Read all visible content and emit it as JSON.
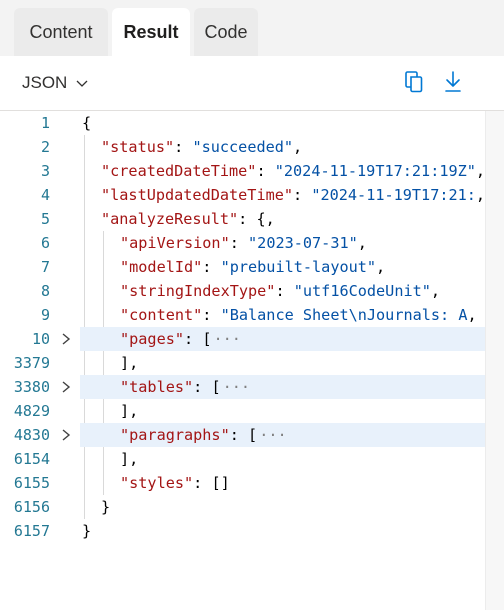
{
  "tabs": [
    {
      "label": "Content"
    },
    {
      "label": "Result"
    },
    {
      "label": "Code"
    }
  ],
  "toolbar": {
    "format_label": "JSON",
    "copy_icon": "copy-icon",
    "download_icon": "download-icon"
  },
  "editor": {
    "lines": [
      {
        "num": "1",
        "key": "",
        "value": "{"
      },
      {
        "num": "2",
        "key": "\"status\"",
        "value": "\"succeeded\""
      },
      {
        "num": "3",
        "key": "\"createdDateTime\"",
        "value": "\"2024-11-19T17:21:19Z\""
      },
      {
        "num": "4",
        "key": "\"lastUpdatedDateTime\"",
        "value": "\"2024-11-19T17:21:"
      },
      {
        "num": "5",
        "key": "\"analyzeResult\"",
        "value": "{"
      },
      {
        "num": "6",
        "key": "\"apiVersion\"",
        "value": "\"2023-07-31\""
      },
      {
        "num": "7",
        "key": "\"modelId\"",
        "value": "\"prebuilt-layout\""
      },
      {
        "num": "8",
        "key": "\"stringIndexType\"",
        "value": "\"utf16CodeUnit\""
      },
      {
        "num": "9",
        "key": "\"content\"",
        "value": "\"Balance Sheet\\nJournals: A"
      },
      {
        "num": "10",
        "key": "\"pages\"",
        "value": "[",
        "collapsed": "···"
      },
      {
        "num": "3379",
        "value": "],"
      },
      {
        "num": "3380",
        "key": "\"tables\"",
        "value": "[",
        "collapsed": "···"
      },
      {
        "num": "4829",
        "value": "],"
      },
      {
        "num": "4830",
        "key": "\"paragraphs\"",
        "value": "[",
        "collapsed": "···"
      },
      {
        "num": "6154",
        "value": "],"
      },
      {
        "num": "6155",
        "key": "\"styles\"",
        "value": "[]"
      },
      {
        "num": "6156",
        "value": "}"
      },
      {
        "num": "6157",
        "value": "}"
      }
    ]
  }
}
